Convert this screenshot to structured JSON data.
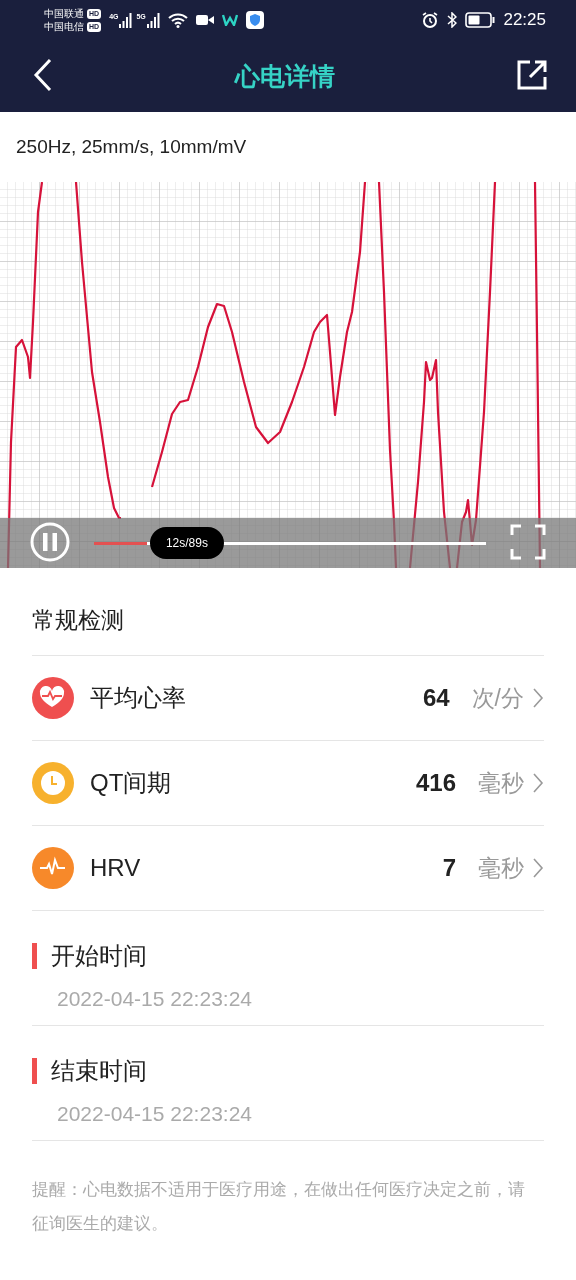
{
  "status_bar": {
    "carriers": [
      {
        "name": "中国联通",
        "badge": "HD"
      },
      {
        "name": "中国电信",
        "badge": "HD"
      }
    ],
    "signals": [
      {
        "label": "4G"
      },
      {
        "label": "5G"
      }
    ],
    "time": "22:25"
  },
  "header": {
    "title": "心电详情"
  },
  "ecg": {
    "settings": "250Hz, 25mm/s, 10mm/mV",
    "playing": true,
    "progress": {
      "level": 0.135,
      "label": "12s/89s"
    }
  },
  "routine": {
    "title": "常规检测",
    "metrics": [
      {
        "kind": "heart",
        "name": "平均心率",
        "value": "64",
        "unit": "次/分"
      },
      {
        "kind": "clock",
        "name": "QT间期",
        "value": "416",
        "unit": "毫秒"
      },
      {
        "kind": "wave",
        "name": "HRV",
        "value": "7",
        "unit": "毫秒"
      }
    ]
  },
  "times": [
    {
      "title": "开始时间",
      "value": "2022-04-15 22:23:24"
    },
    {
      "title": "结束时间",
      "value": "2022-04-15 22:23:24"
    }
  ],
  "notice": "提醒：心电数据不适用于医疗用途，在做出任何医疗决定之前，请征询医生的建议。"
}
